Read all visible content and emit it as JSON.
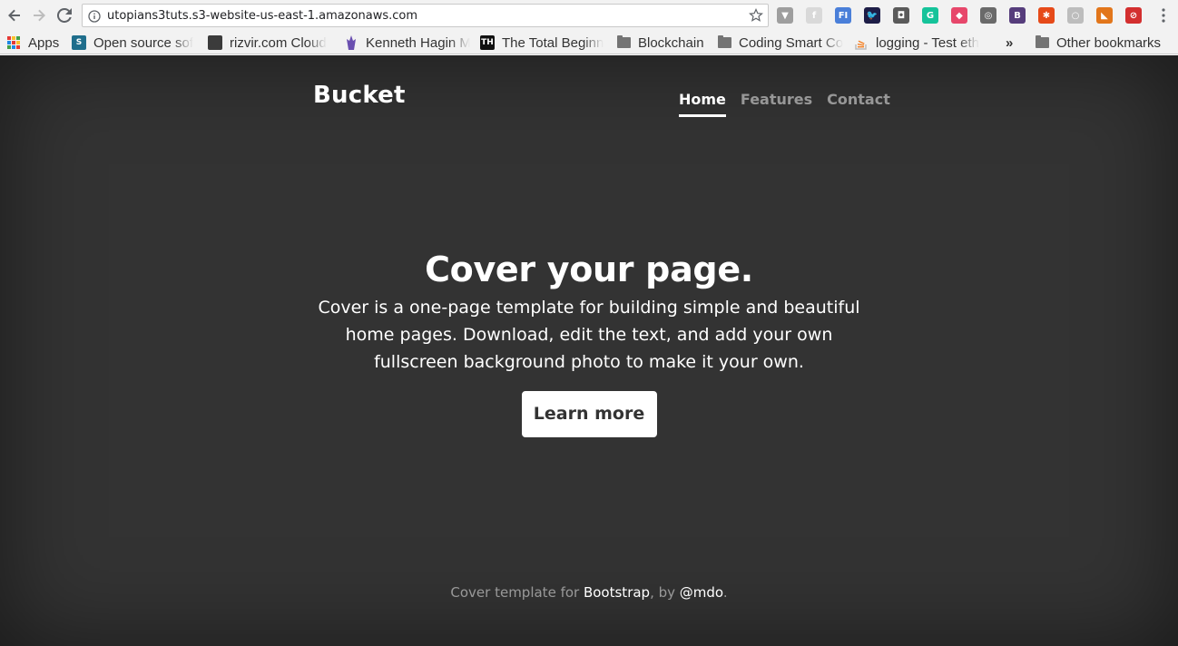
{
  "browser": {
    "url": "utopians3tuts.s3-website-us-east-1.amazonaws.com",
    "bookmarks": [
      {
        "label": "Apps"
      },
      {
        "label": "Open source sof",
        "icon_text": "S",
        "color": "#1f6e8c"
      },
      {
        "label": "rizvir.com Cloud"
      },
      {
        "label": "Kenneth Hagin M"
      },
      {
        "label": "The Total Beginn",
        "icon_text": "TH",
        "color": "#111111"
      },
      {
        "label": "Blockchain"
      },
      {
        "label": "Coding Smart Co"
      },
      {
        "label": "logging - Test eth"
      },
      {
        "label": "Other bookmarks"
      }
    ],
    "overflow_label": "»",
    "extensions": [
      {
        "name": "vuejs-devtools-icon",
        "text": "▼",
        "color": "#9e9e9e"
      },
      {
        "name": "formula-icon",
        "text": "f",
        "color": "#d9d9d9"
      },
      {
        "name": "fi-extension-icon",
        "text": "FI",
        "color": "#4a7fd9"
      },
      {
        "name": "twitter-bird-icon",
        "text": "🐦",
        "color": "#1d1d47"
      },
      {
        "name": "lock-extension-icon",
        "text": "◘",
        "color": "#5a5a5a"
      },
      {
        "name": "grammarly-icon",
        "text": "G",
        "color": "#15c39a"
      },
      {
        "name": "tag-extension-icon",
        "text": "◆",
        "color": "#e7476b"
      },
      {
        "name": "coin-extension-icon",
        "text": "◎",
        "color": "#6a6a6a"
      },
      {
        "name": "bootstrap-icon",
        "text": "B",
        "color": "#563d7c"
      },
      {
        "name": "pinwheel-icon",
        "text": "✱",
        "color": "#e64a19"
      },
      {
        "name": "circle-extension-icon",
        "text": "○",
        "color": "#bdbdbd"
      },
      {
        "name": "metamask-icon",
        "text": "◣",
        "color": "#e2761b"
      },
      {
        "name": "stop-extension-icon",
        "text": "⊘",
        "color": "#d32f2f"
      }
    ]
  },
  "site": {
    "brand": "Bucket",
    "nav": [
      {
        "label": "Home",
        "active": true
      },
      {
        "label": "Features",
        "active": false
      },
      {
        "label": "Contact",
        "active": false
      }
    ],
    "hero": {
      "title": "Cover your page.",
      "lead": "Cover is a one-page template for building simple and beautiful home pages. Download, edit the text, and add your own fullscreen background photo to make it your own.",
      "button": "Learn more"
    },
    "footer": {
      "prefix": "Cover template for ",
      "link1": "Bootstrap",
      "middle": ", by ",
      "link2": "@mdo",
      "suffix": "."
    }
  },
  "colors": {
    "page_bg": "#333333",
    "chrome_bg": "#f2f2f2",
    "nav_inactive": "rgba(255,255,255,0.5)"
  }
}
